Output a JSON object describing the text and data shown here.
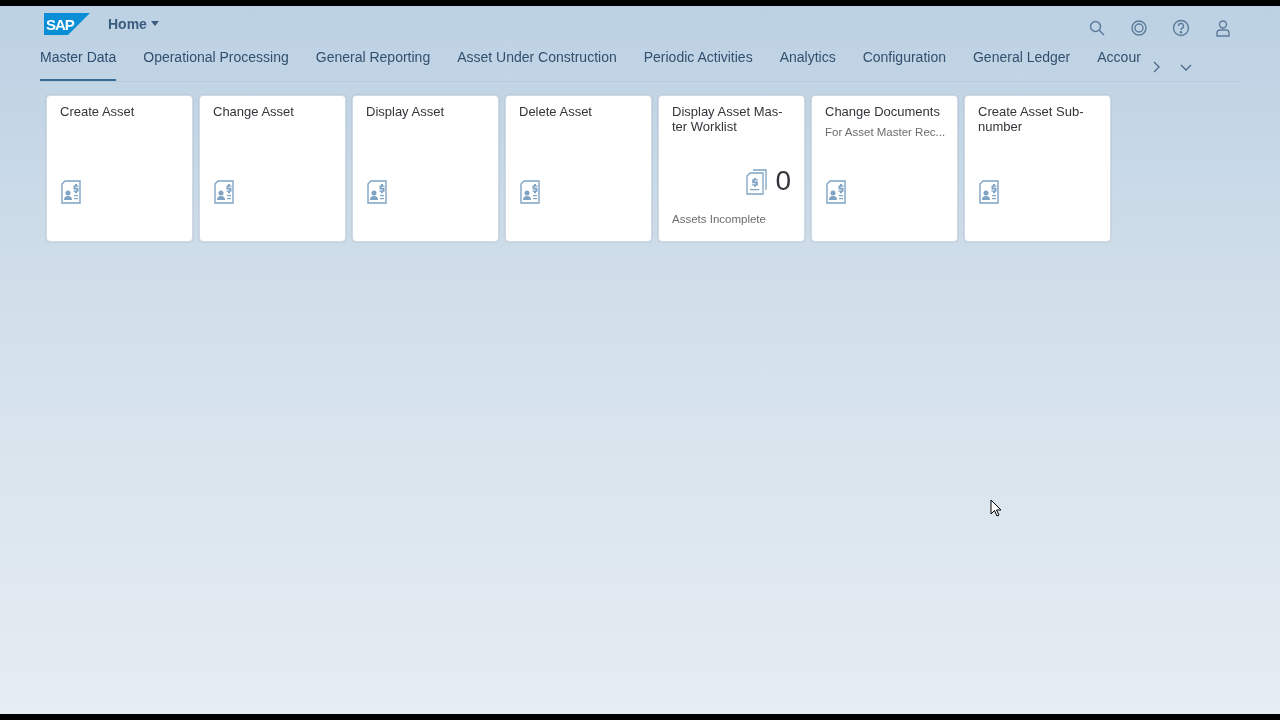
{
  "shell": {
    "logo": "SAP",
    "title": "Home"
  },
  "tabs": [
    {
      "label": "Master Data",
      "selected": true
    },
    {
      "label": "Operational Processing",
      "selected": false
    },
    {
      "label": "General Reporting",
      "selected": false
    },
    {
      "label": "Asset Under Construction",
      "selected": false
    },
    {
      "label": "Periodic Activities",
      "selected": false
    },
    {
      "label": "Analytics",
      "selected": false
    },
    {
      "label": "Configuration",
      "selected": false
    },
    {
      "label": "General Ledger",
      "selected": false
    },
    {
      "label": "Accour",
      "selected": false
    }
  ],
  "tiles": [
    {
      "kind": "launch",
      "title": "Create Asset"
    },
    {
      "kind": "launch",
      "title": "Change Asset"
    },
    {
      "kind": "launch",
      "title": "Display Asset"
    },
    {
      "kind": "launch",
      "title": "Delete Asset"
    },
    {
      "kind": "kpi",
      "title": "Display Asset Mas-\nter Worklist",
      "value": "0",
      "footer": "Assets Incomplete"
    },
    {
      "kind": "launch",
      "title": "Change Documents",
      "subtitle": "For Asset Master Rec..."
    },
    {
      "kind": "launch",
      "title": "Create Asset Sub-\nnumber"
    }
  ]
}
